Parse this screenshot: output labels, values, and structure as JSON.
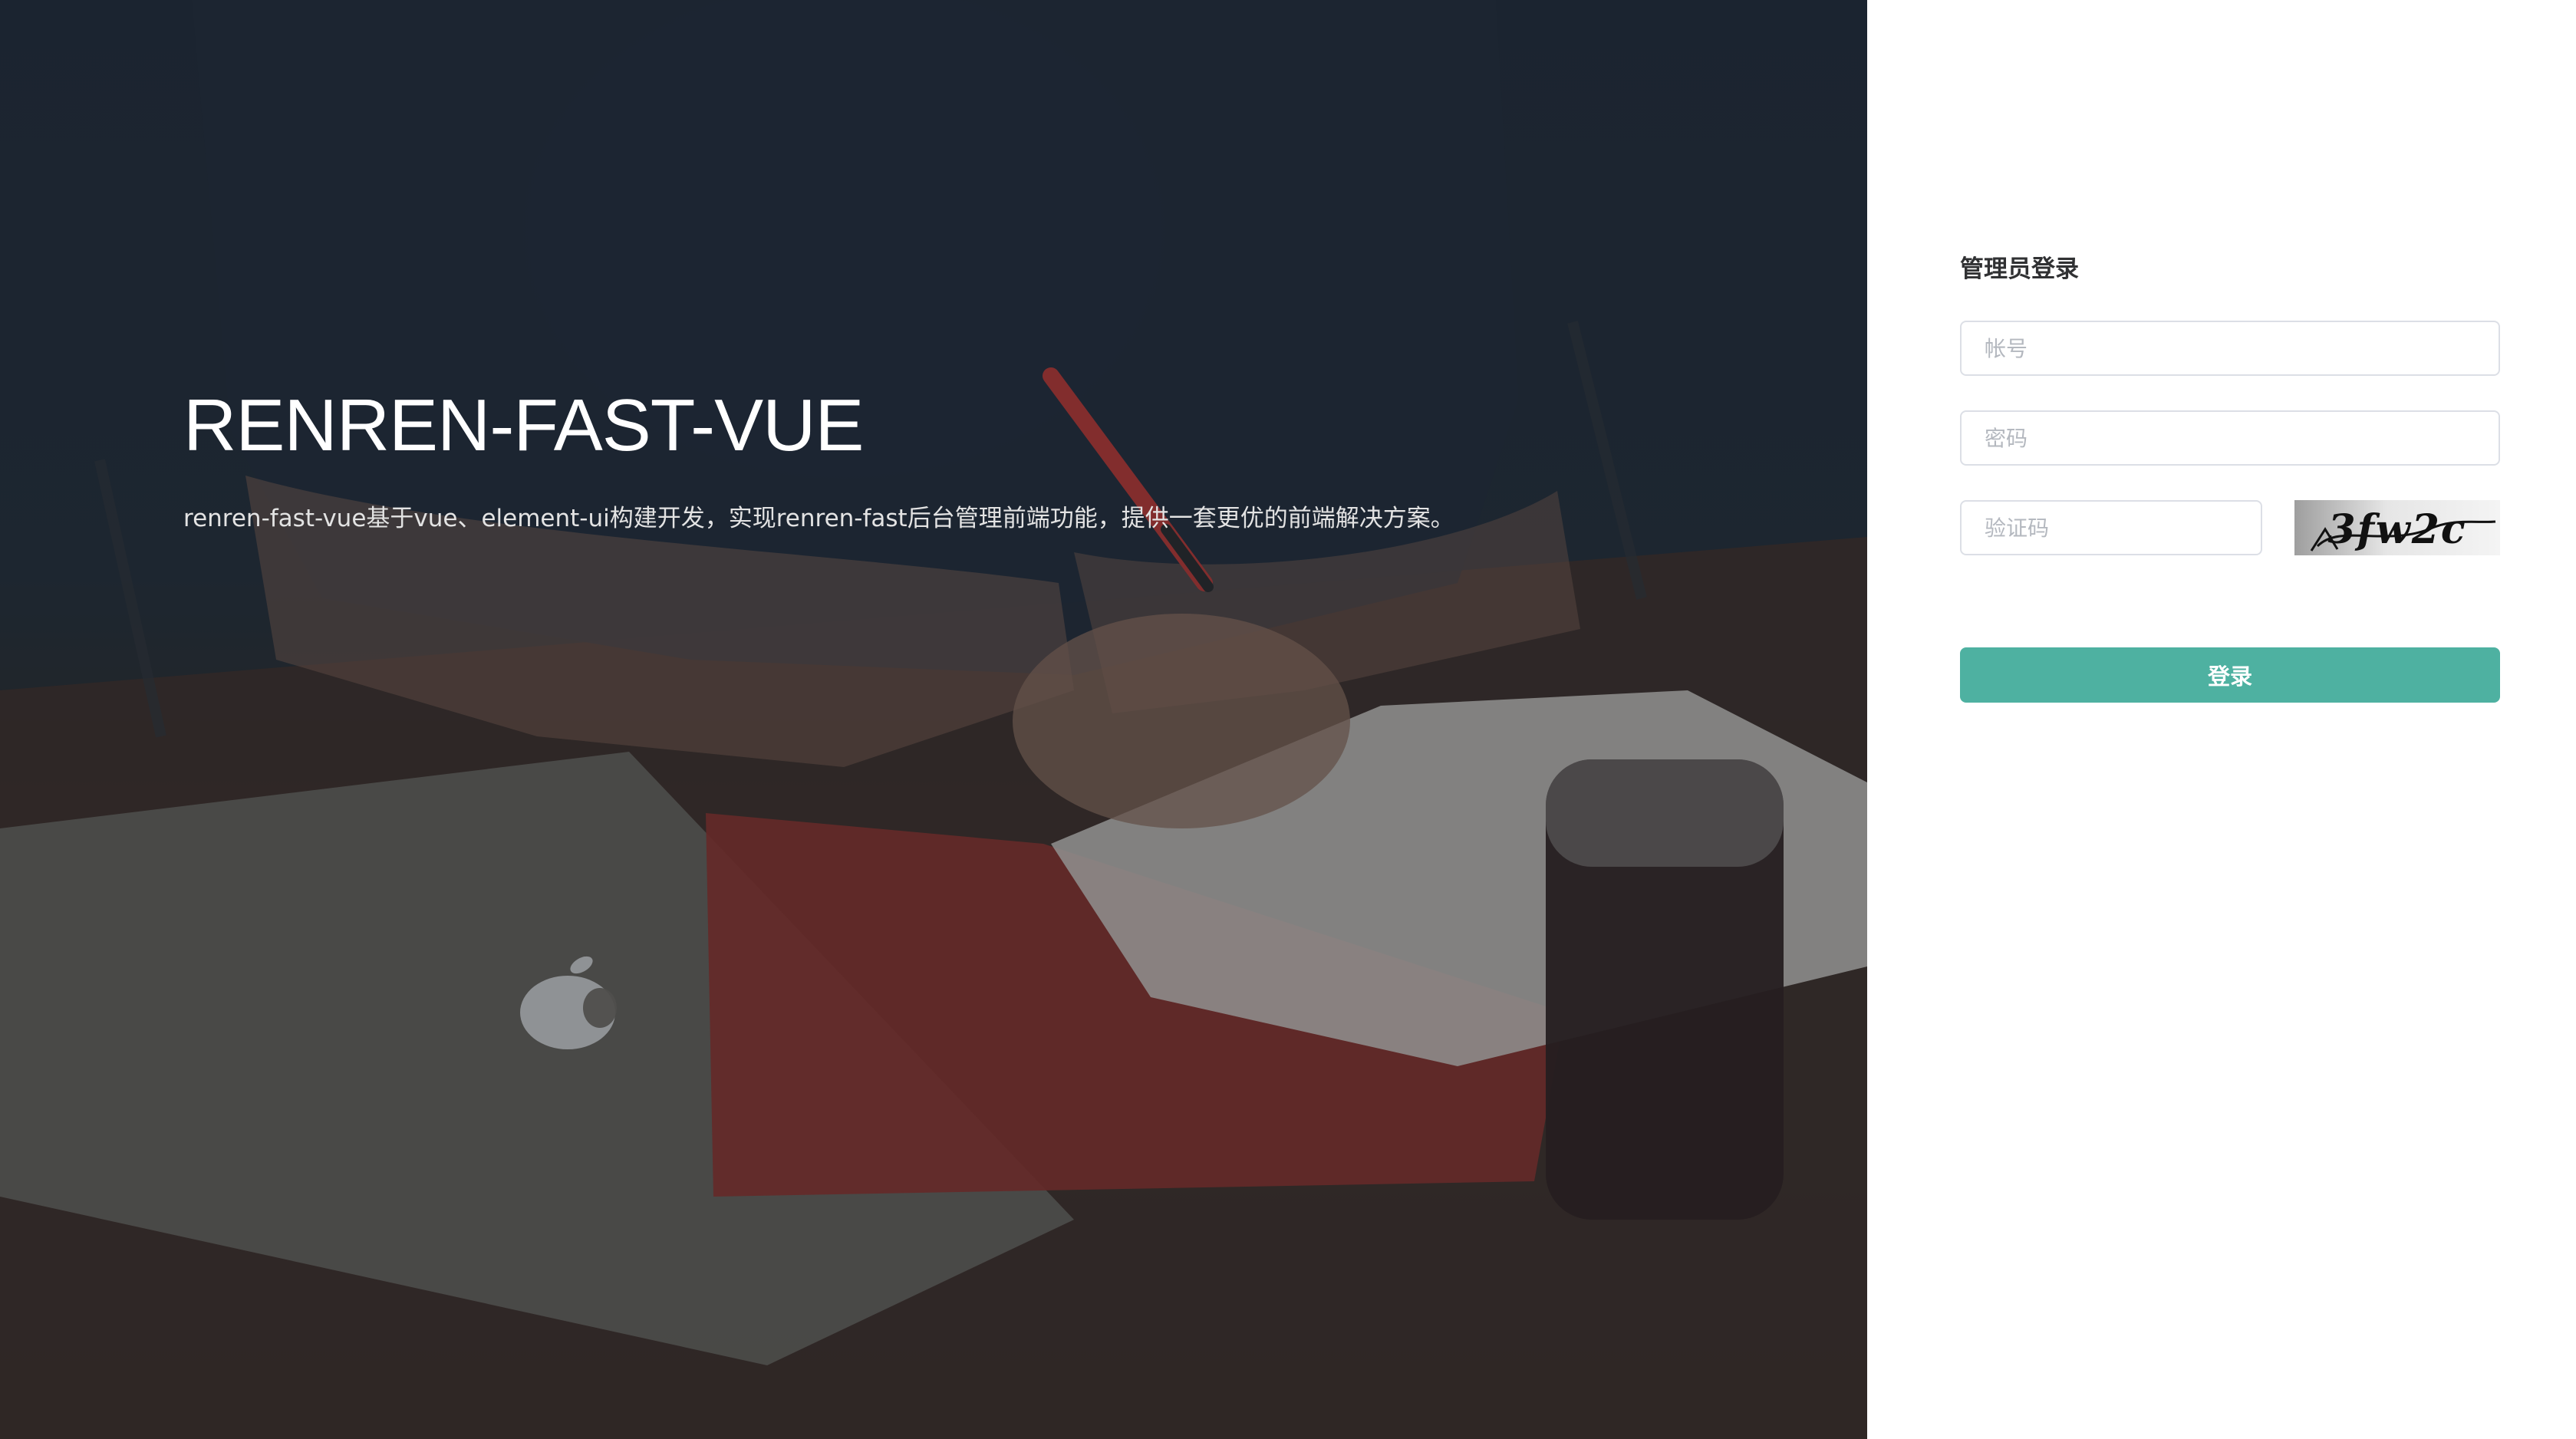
{
  "hero": {
    "title": "RENREN-FAST-VUE",
    "description": "renren-fast-vue基于vue、element-ui构建开发，实现renren-fast后台管理前端功能，提供一套更优的前端解决方案。"
  },
  "login": {
    "title": "管理员登录",
    "username_placeholder": "帐号",
    "password_placeholder": "密码",
    "captcha_placeholder": "验证码",
    "captcha_text": "3fw2c",
    "submit_label": "登录"
  },
  "colors": {
    "accent": "#4eb1a1",
    "panel_bg": "#ffffff",
    "input_border": "#dcdfe6",
    "placeholder": "#b4b8bf",
    "title_text": "#303133"
  },
  "icons": {
    "laptop_logo": "apple-logo-icon"
  }
}
